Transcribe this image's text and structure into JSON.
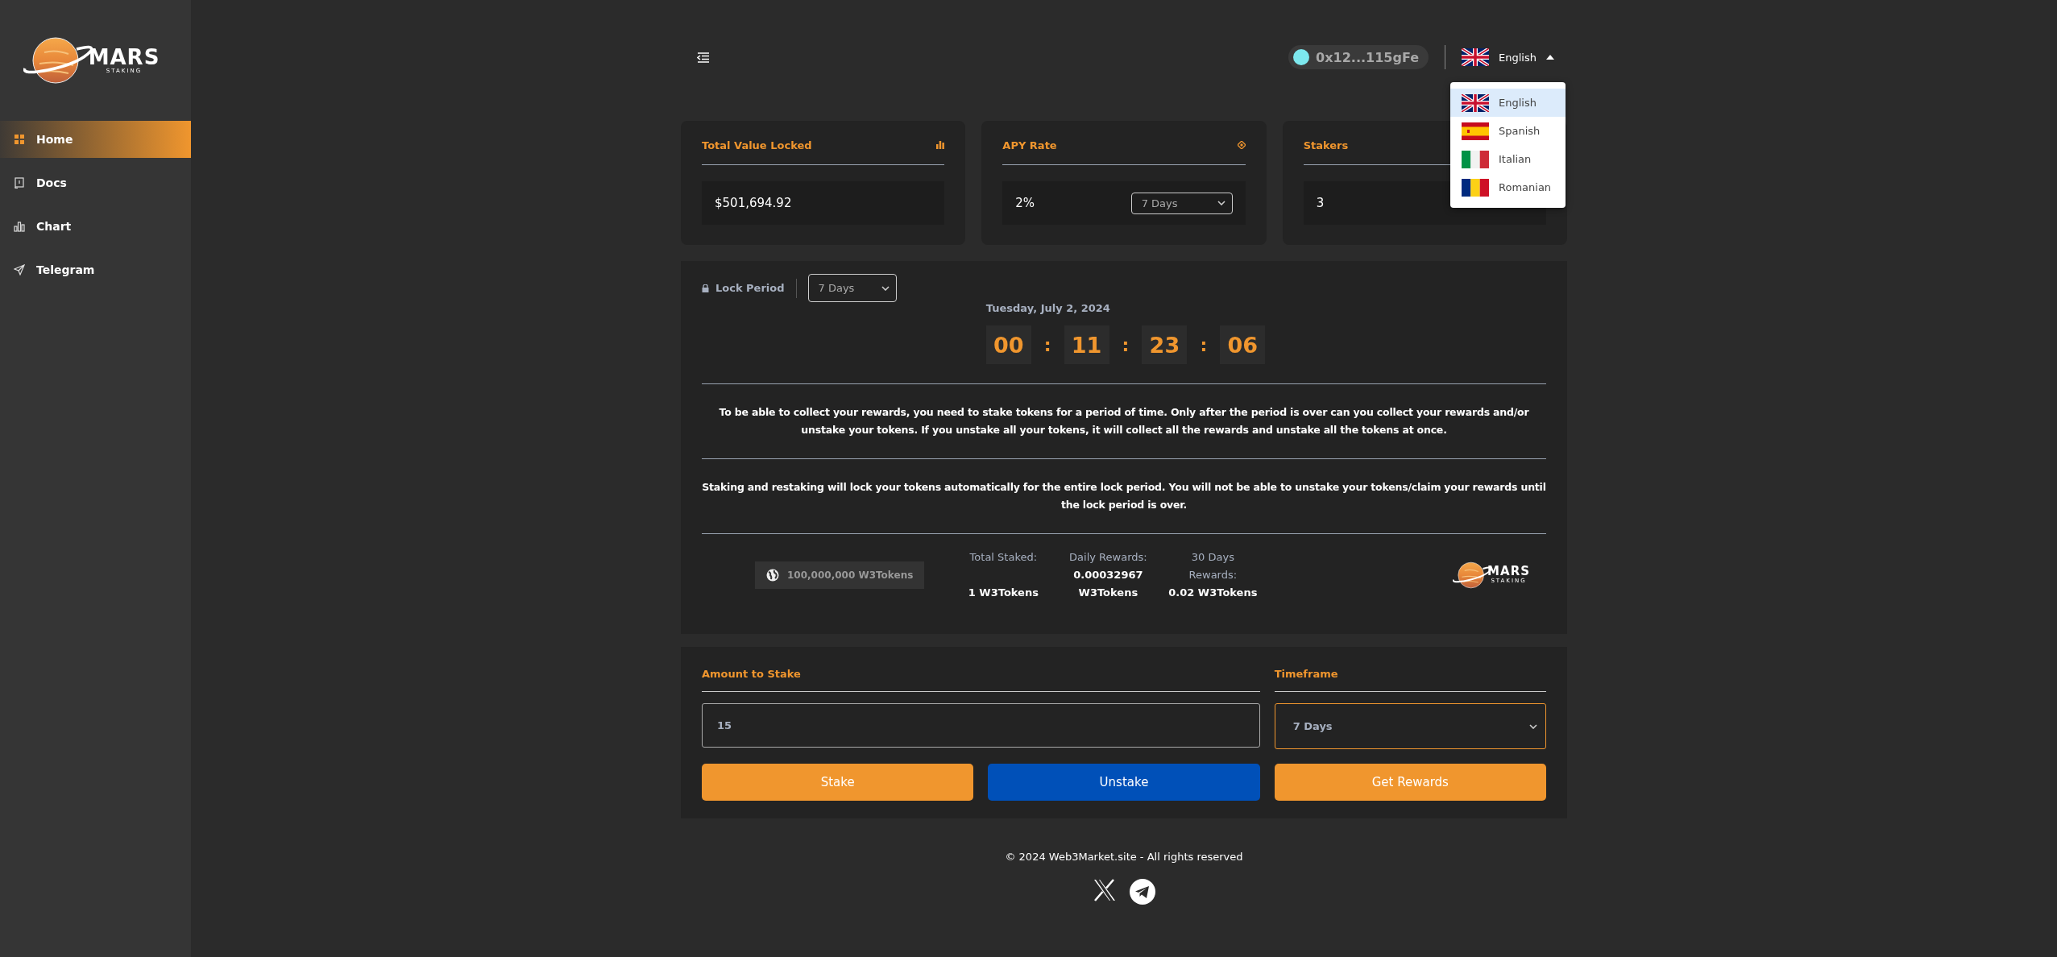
{
  "sidebar": {
    "logo": {
      "title": "MARS",
      "subtitle": "STAKING"
    },
    "items": [
      {
        "label": "Home",
        "kind": "grid",
        "selected": true
      },
      {
        "label": "Docs",
        "kind": "book",
        "selected": false
      },
      {
        "label": "Chart",
        "kind": "bars",
        "selected": false
      },
      {
        "label": "Telegram",
        "kind": "send",
        "selected": false
      }
    ]
  },
  "header": {
    "wallet": "0x12...115gFe",
    "language": "English",
    "language_menu": [
      {
        "label": "English",
        "kind": "uk",
        "selected": true
      },
      {
        "label": "Spanish",
        "kind": "es",
        "selected": false
      },
      {
        "label": "Italian",
        "kind": "it",
        "selected": false
      },
      {
        "label": "Romanian",
        "kind": "ro",
        "selected": false
      }
    ]
  },
  "cards": [
    {
      "title": "Total Value Locked",
      "value": "$501,694.92",
      "kind": "chart"
    },
    {
      "title": "APY Rate",
      "value": "2%",
      "select": "7 Days",
      "kind": "target"
    },
    {
      "title": "Stakers",
      "value": "3",
      "kind": "none"
    }
  ],
  "lock": {
    "label": "Lock Period",
    "select": "7 Days",
    "date": "Tuesday, July 2, 2024",
    "countdown": [
      {
        "kind": "digits",
        "text": "00"
      },
      {
        "kind": "colon",
        "text": ":"
      },
      {
        "kind": "digits",
        "text": "11"
      },
      {
        "kind": "colon",
        "text": ":"
      },
      {
        "kind": "digits",
        "text": "23"
      },
      {
        "kind": "colon",
        "text": ":"
      },
      {
        "kind": "digits",
        "text": "06"
      }
    ],
    "notes": [
      "To be able to collect your rewards, you need to stake tokens for a period of time. Only after the period is over can you collect your rewards and/or unstake your tokens. If you unstake all your tokens, it will collect all the rewards and unstake all the tokens at once.",
      "Staking and restaking will lock your tokens automatically for the entire lock period. You will not be able to unstake your tokens/claim your rewards until the lock period is over."
    ],
    "supply": "100,000,000 W3Tokens",
    "stats": [
      {
        "label": "Total Staked:",
        "value": "1 W3Tokens"
      },
      {
        "label": "Daily Rewards:",
        "value": "0.00032967 W3Tokens"
      },
      {
        "label": "30 Days Rewards:",
        "value": "0.02 W3Tokens"
      }
    ],
    "logo": {
      "title": "MARS",
      "subtitle": "STAKING"
    }
  },
  "stake": {
    "amount_label": "Amount to Stake",
    "amount_value": "15",
    "timeframe_label": "Timeframe",
    "timeframe_value": "7 Days",
    "buttons": [
      {
        "label": "Stake",
        "kind": "primary"
      },
      {
        "label": "Unstake",
        "kind": "secondary"
      },
      {
        "label": "Get Rewards",
        "kind": "primary"
      }
    ]
  },
  "footer": {
    "copyright": "© 2024 Web3Market.site - All rights reserved",
    "social": [
      {
        "kind": "x"
      },
      {
        "kind": "telegram"
      }
    ]
  }
}
